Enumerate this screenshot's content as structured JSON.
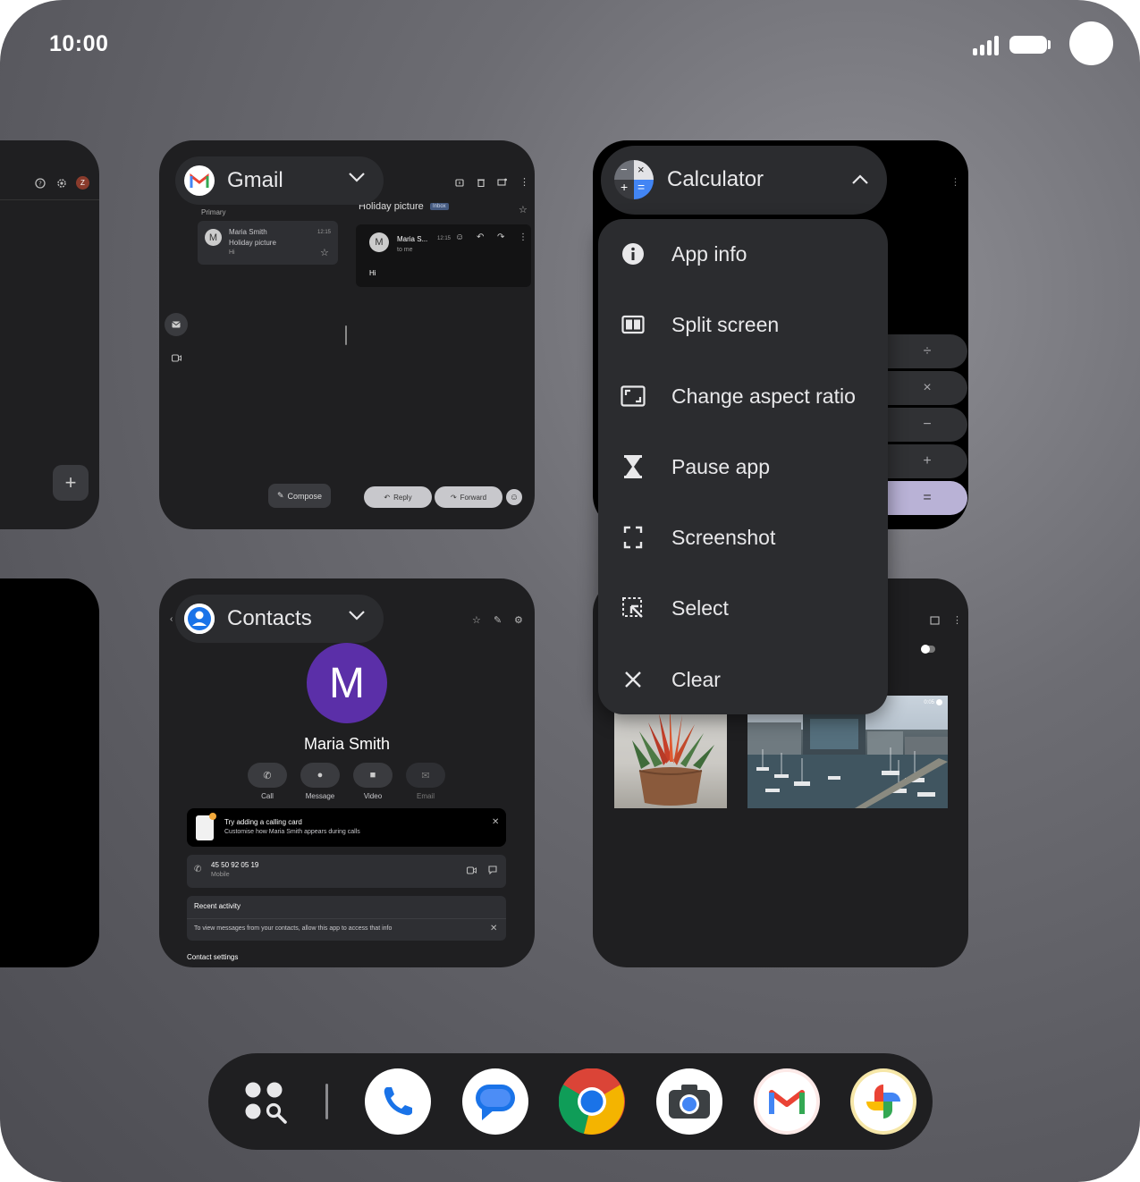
{
  "status_bar": {
    "time": "10:00"
  },
  "gmail_card": {
    "app_name": "Gmail",
    "primary_label": "Primary",
    "list_sender": "Maria Smith",
    "list_subject": "Holiday picture",
    "list_snippet": "Hi",
    "list_time": "12:15",
    "avatar_letter": "M",
    "detail_subject": "Holiday picture",
    "detail_badge": "Inbox",
    "detail_sender": "Maria S...",
    "detail_time": "12:15",
    "detail_to": "to me",
    "detail_body": "Hi",
    "compose_label": "Compose",
    "reply_label": "Reply",
    "forward_label": "Forward"
  },
  "calculator_card": {
    "app_name": "Calculator",
    "buttons": [
      "÷",
      "×",
      "−",
      "+",
      "="
    ]
  },
  "app_menu": {
    "items": [
      {
        "label": "App info",
        "icon": "info-icon"
      },
      {
        "label": "Split screen",
        "icon": "split-screen-icon"
      },
      {
        "label": "Change aspect ratio",
        "icon": "aspect-ratio-icon"
      },
      {
        "label": "Pause app",
        "icon": "hourglass-icon"
      },
      {
        "label": "Screenshot",
        "icon": "screenshot-icon"
      },
      {
        "label": "Select",
        "icon": "select-icon"
      },
      {
        "label": "Clear",
        "icon": "close-icon"
      }
    ]
  },
  "contacts_card": {
    "app_name": "Contacts",
    "avatar_letter": "M",
    "contact_name": "Maria Smith",
    "actions": [
      "Call",
      "Message",
      "Video",
      "Email"
    ],
    "calling_card_title": "Try adding a calling card",
    "calling_card_subtitle": "Customise how Maria Smith appears during calls",
    "phone_number": "45 50 92 05 19",
    "phone_type": "Mobile",
    "recent_activity": "Recent activity",
    "recent_activity_note": "To view messages from your contacts, allow this app to access that info",
    "contact_settings": "Contact settings"
  },
  "photos_card": {
    "video_time": "0:05"
  },
  "left_card": {
    "avatar_letter": "Z"
  },
  "taskbar": {
    "apps": [
      "App drawer",
      "Phone",
      "Messages",
      "Chrome",
      "Camera",
      "Gmail",
      "Photos"
    ]
  },
  "colors": {
    "gmail_red": "#ea4335",
    "google_blue": "#4285f4",
    "google_yellow": "#fbbc04",
    "google_green": "#34a853",
    "contact_avatar": "#5b2fa8",
    "calc_equals": "#b9b2d6"
  }
}
